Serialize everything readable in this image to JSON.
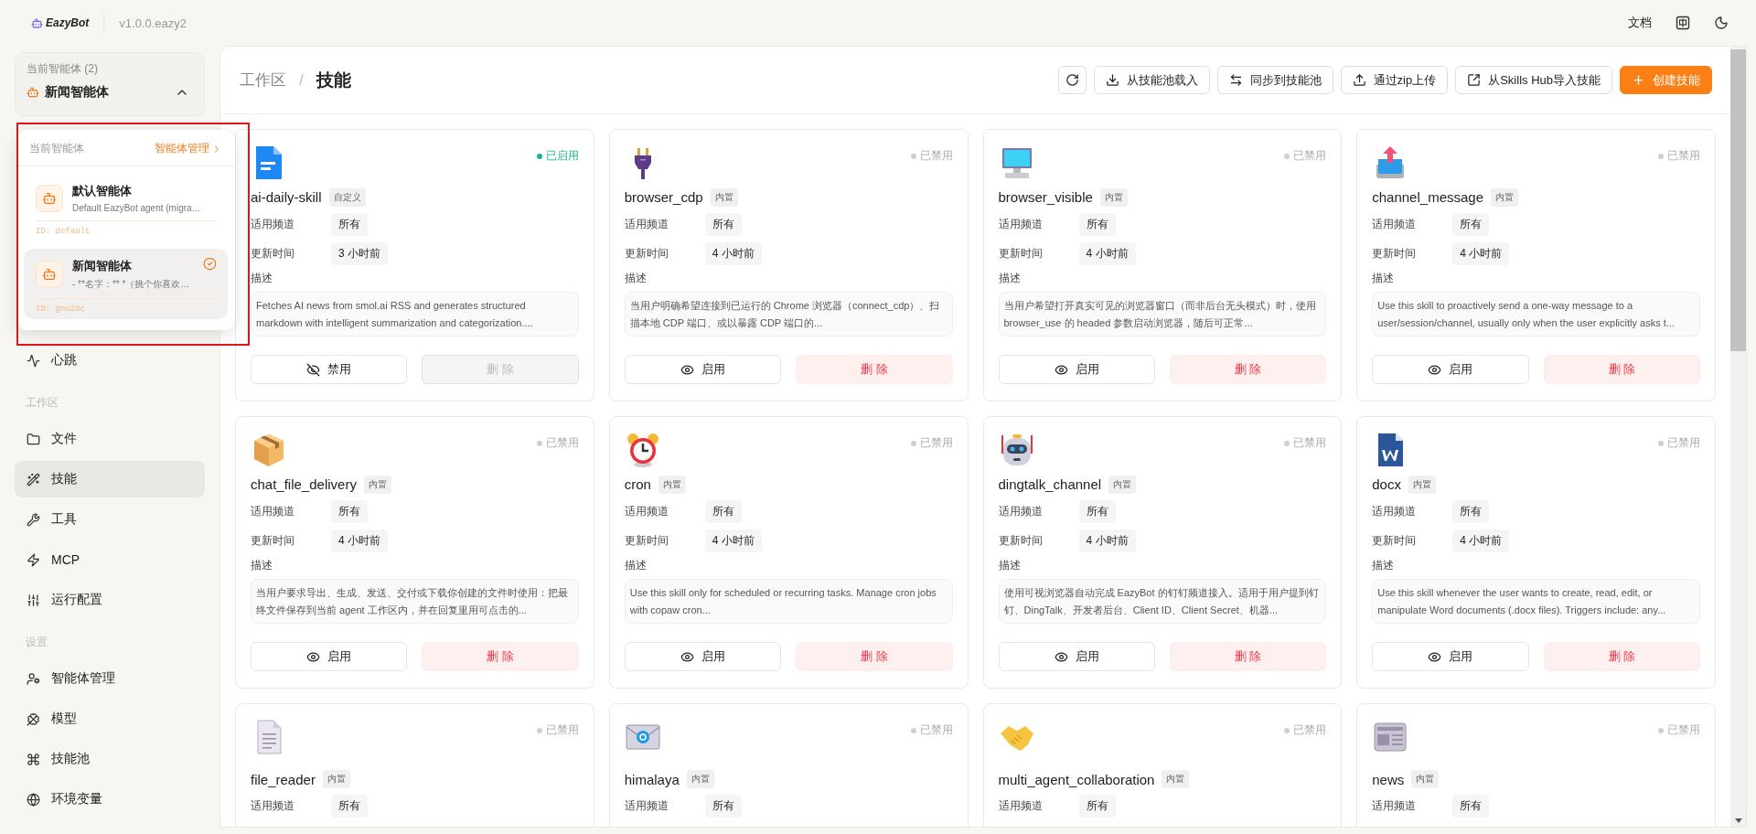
{
  "app": {
    "logo": "EazyBot",
    "version": "v1.0.0.eazy2",
    "docs_link": "文档"
  },
  "agent_selector": {
    "label": "当前智能体 (2)",
    "name": "新闻智能体",
    "expanded": true
  },
  "agent_menu": {
    "title": "当前智能体",
    "manage_link": "智能体管理",
    "agents": [
      {
        "name": "默认智能体",
        "description": "Default EazyBot agent (migra…",
        "id": "ID: default",
        "selected": false
      },
      {
        "name": "新闻智能体",
        "description": "- **名字：** *（挑个你喜欢…",
        "id": "ID: gnu28c",
        "selected": true
      }
    ]
  },
  "annotation": {
    "kind": "frame"
  },
  "sidebar": {
    "sections": [
      {
        "items": [
          {
            "label": "心跳",
            "selected": false
          }
        ]
      },
      {
        "title": "工作区",
        "items": [
          {
            "label": "文件",
            "selected": false
          },
          {
            "label": "技能",
            "selected": true
          },
          {
            "label": "工具",
            "selected": false
          },
          {
            "label": "MCP",
            "selected": false
          },
          {
            "label": "运行配置",
            "selected": false
          }
        ]
      },
      {
        "title": "设置",
        "items": [
          {
            "label": "智能体管理",
            "selected": false
          },
          {
            "label": "模型",
            "selected": false
          },
          {
            "label": "技能池",
            "selected": false
          },
          {
            "label": "环境变量",
            "selected": false
          }
        ]
      }
    ]
  },
  "breadcrumb": [
    "工作区",
    "技能"
  ],
  "breadcrumb_separator": "/",
  "toolbar": [
    {
      "kind": "icon"
    },
    {
      "kind": "default",
      "label": "从技能池载入"
    },
    {
      "kind": "default",
      "label": "同步到技能池"
    },
    {
      "kind": "default",
      "label": "通过zip上传"
    },
    {
      "kind": "default",
      "label": "从Skills Hub导入技能"
    },
    {
      "kind": "primary",
      "label": "创建技能"
    }
  ],
  "cards": [
    {
      "name": "ai-daily-skill",
      "tag": "自定义",
      "enabled": true,
      "status": "已启用",
      "channel_label": "适用频道",
      "channel": "所有",
      "time_label": "更新时间",
      "time": "3 小时前",
      "desc_label": "描述",
      "description": "Fetches AI news from smol.ai RSS and generates structured markdown with intelligent summarization and categorization....",
      "toggle": "禁用",
      "delete": "删 除"
    },
    {
      "name": "browser_cdp",
      "tag": "内置",
      "enabled": false,
      "status": "已禁用",
      "channel_label": "适用频道",
      "channel": "所有",
      "time_label": "更新时间",
      "time": "4 小时前",
      "desc_label": "描述",
      "description": "当用户明确希望连接到已运行的 Chrome 浏览器（connect_cdp）、扫描本地 CDP 端口、或以暴露 CDP 端口的...",
      "toggle": "启用",
      "delete": "删 除"
    },
    {
      "name": "browser_visible",
      "tag": "内置",
      "enabled": false,
      "status": "已禁用",
      "channel_label": "适用频道",
      "channel": "所有",
      "time_label": "更新时间",
      "time": "4 小时前",
      "desc_label": "描述",
      "description": "当用户希望打开真实可见的浏览器窗口（而非后台无头模式）时，使用 browser_use 的 headed 参数启动浏览器，随后可正常...",
      "toggle": "启用",
      "delete": "删 除"
    },
    {
      "name": "channel_message",
      "tag": "内置",
      "enabled": false,
      "status": "已禁用",
      "channel_label": "适用频道",
      "channel": "所有",
      "time_label": "更新时间",
      "time": "4 小时前",
      "desc_label": "描述",
      "description": "Use this skill to proactively send a one-way message to a user/session/channel, usually only when the user explicitly asks t...",
      "toggle": "启用",
      "delete": "删 除"
    },
    {
      "name": "chat_file_delivery",
      "tag": "内置",
      "enabled": false,
      "status": "已禁用",
      "channel_label": "适用频道",
      "channel": "所有",
      "time_label": "更新时间",
      "time": "4 小时前",
      "desc_label": "描述",
      "description": "当用户要求导出、生成、发送、交付或下载你创建的文件时使用：把最终文件保存到当前 agent 工作区内，并在回复里用可点击的...",
      "toggle": "启用",
      "delete": "删 除"
    },
    {
      "name": "cron",
      "tag": "内置",
      "enabled": false,
      "status": "已禁用",
      "channel_label": "适用频道",
      "channel": "所有",
      "time_label": "更新时间",
      "time": "4 小时前",
      "desc_label": "描述",
      "description": "Use this skill only for scheduled or recurring tasks. Manage cron jobs with copaw cron...",
      "toggle": "启用",
      "delete": "删 除"
    },
    {
      "name": "dingtalk_channel",
      "tag": "内置",
      "enabled": false,
      "status": "已禁用",
      "channel_label": "适用频道",
      "channel": "所有",
      "time_label": "更新时间",
      "time": "4 小时前",
      "desc_label": "描述",
      "description": "使用可视浏览器自动完成 EazyBot 的钉钉频道接入。适用于用户提到钉钉、DingTalk、开发者后台、Client ID、Client Secret、机器...",
      "toggle": "启用",
      "delete": "删 除"
    },
    {
      "name": "docx",
      "tag": "内置",
      "enabled": false,
      "status": "已禁用",
      "channel_label": "适用频道",
      "channel": "所有",
      "time_label": "更新时间",
      "time": "4 小时前",
      "desc_label": "描述",
      "description": "Use this skill whenever the user wants to create, read, edit, or manipulate Word documents (.docx files). Triggers include: any...",
      "toggle": "启用",
      "delete": "删 除"
    },
    {
      "name": "file_reader",
      "tag": "内置",
      "enabled": false,
      "status": "已禁用",
      "channel_label": "适用频道",
      "channel": "所有"
    },
    {
      "name": "himalaya",
      "tag": "内置",
      "enabled": false,
      "status": "已禁用",
      "channel_label": "适用频道",
      "channel": "所有"
    },
    {
      "name": "multi_agent_collaboration",
      "tag": "内置",
      "enabled": false,
      "status": "已禁用",
      "channel_label": "适用频道",
      "channel": "所有"
    },
    {
      "name": "news",
      "tag": "内置",
      "enabled": false,
      "status": "已禁用",
      "channel_label": "适用频道",
      "channel": "所有"
    }
  ]
}
